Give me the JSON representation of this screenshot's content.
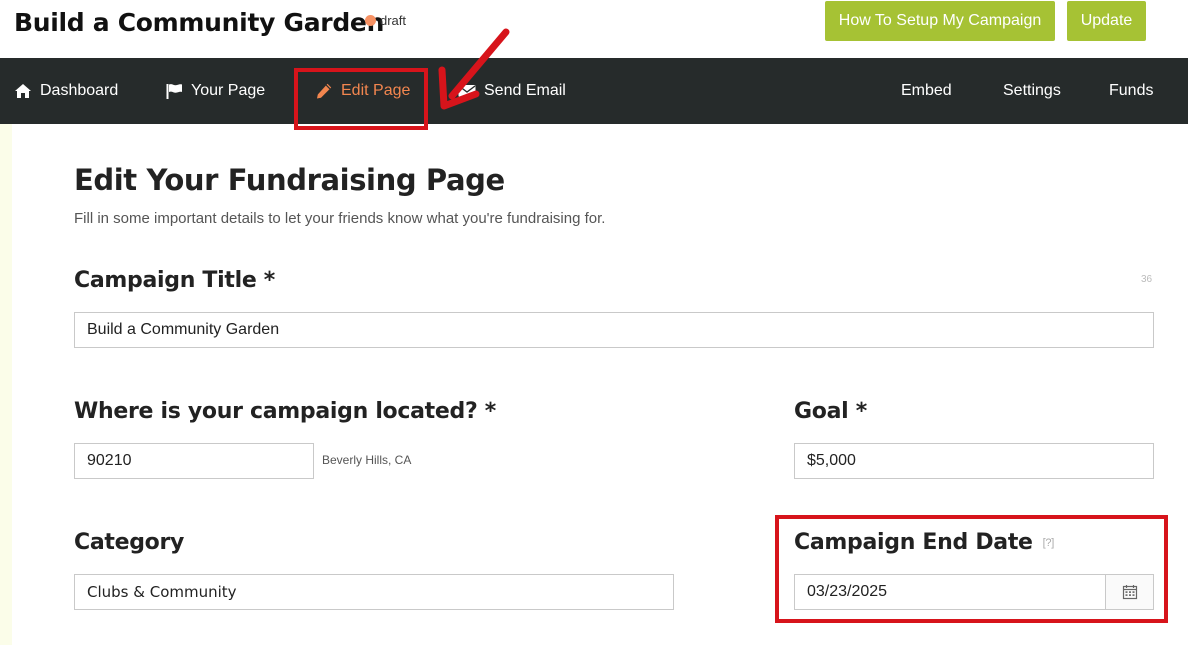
{
  "header": {
    "title": "Build a Community Garden",
    "status": "draft",
    "setup_button": "How To Setup My Campaign",
    "update_button": "Update"
  },
  "nav": {
    "dashboard": "Dashboard",
    "your_page": "Your Page",
    "edit_page": "Edit Page",
    "send_email": "Send Email",
    "embed": "Embed",
    "settings": "Settings",
    "funds": "Funds",
    "active": "Edit Page"
  },
  "content": {
    "title": "Edit Your Fundraising Page",
    "subtitle": "Fill in some important details to let your friends know what you're fundraising for."
  },
  "fields": {
    "campaign_title": {
      "label": "Campaign Title *",
      "value": "Build a Community Garden",
      "char_count": "36"
    },
    "location": {
      "label": "Where is your campaign located? *",
      "value": "90210",
      "hint": "Beverly Hills, CA"
    },
    "goal": {
      "label": "Goal *",
      "value": "$5,000"
    },
    "category": {
      "label": "Category",
      "value": "Clubs & Community"
    },
    "end_date": {
      "label": "Campaign End Date",
      "help": "[?]",
      "value": "03/23/2025"
    }
  },
  "icons": {
    "dashboard": "home-icon",
    "your_page": "flag-icon",
    "edit_page": "pencil-icon",
    "send_email": "envelope-icon",
    "date": "calendar-icon"
  },
  "colors": {
    "accent_green": "#a6c234",
    "nav_background": "#262b2b",
    "active_nav": "#f2864f",
    "annotation_red": "#d7141b",
    "status_dot": "#f79264"
  }
}
